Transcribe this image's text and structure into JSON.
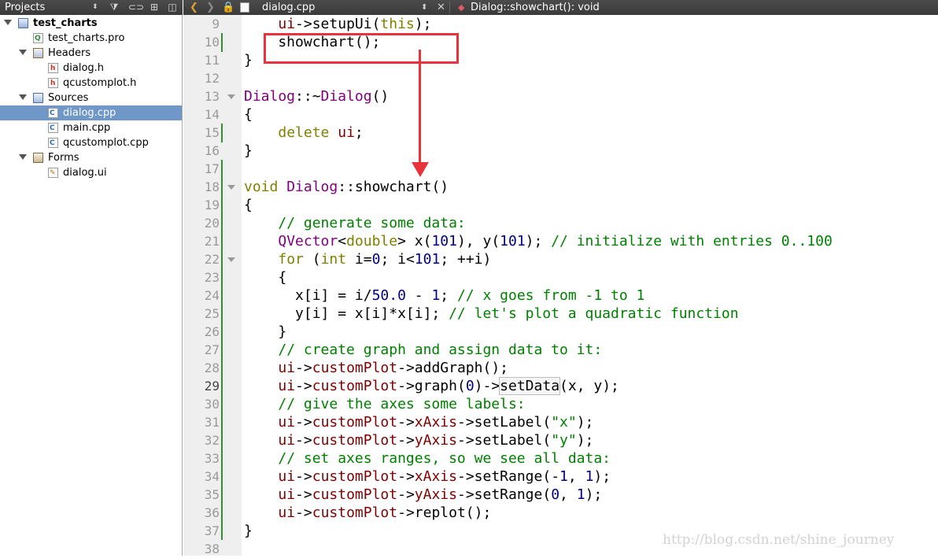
{
  "project_panel": {
    "title": "Projects",
    "tree": [
      {
        "label": "test_charts",
        "kind": "project",
        "level": 0,
        "expanded": true,
        "bold": true
      },
      {
        "label": "test_charts.pro",
        "kind": "file-pro",
        "level": 1
      },
      {
        "label": "Headers",
        "kind": "folder-h",
        "level": 1,
        "expanded": true
      },
      {
        "label": "dialog.h",
        "kind": "file-h",
        "level": 2
      },
      {
        "label": "qcustomplot.h",
        "kind": "file-h",
        "level": 2
      },
      {
        "label": "Sources",
        "kind": "folder-c",
        "level": 1,
        "expanded": true
      },
      {
        "label": "dialog.cpp",
        "kind": "file-c",
        "level": 2,
        "selected": true
      },
      {
        "label": "main.cpp",
        "kind": "file-c",
        "level": 2
      },
      {
        "label": "qcustomplot.cpp",
        "kind": "file-c",
        "level": 2
      },
      {
        "label": "Forms",
        "kind": "folder-f",
        "level": 1,
        "expanded": true
      },
      {
        "label": "dialog.ui",
        "kind": "file-ui",
        "level": 2
      }
    ]
  },
  "editor": {
    "file_name": "dialog.cpp",
    "symbol": "Dialog::showchart(): void",
    "current_line": 29,
    "lines": [
      {
        "no": 9,
        "text": "    ui->setupUi(this);"
      },
      {
        "no": 10,
        "text": "    showchart();"
      },
      {
        "no": 11,
        "text": "}"
      },
      {
        "no": 12,
        "text": ""
      },
      {
        "no": 13,
        "text": "Dialog::~Dialog()"
      },
      {
        "no": 14,
        "text": "{"
      },
      {
        "no": 15,
        "text": "    delete ui;"
      },
      {
        "no": 16,
        "text": "}"
      },
      {
        "no": 17,
        "text": ""
      },
      {
        "no": 18,
        "text": "void Dialog::showchart()"
      },
      {
        "no": 19,
        "text": "{"
      },
      {
        "no": 20,
        "text": "    // generate some data:"
      },
      {
        "no": 21,
        "text": "    QVector<double> x(101), y(101); // initialize with entries 0..100"
      },
      {
        "no": 22,
        "text": "    for (int i=0; i<101; ++i)"
      },
      {
        "no": 23,
        "text": "    {"
      },
      {
        "no": 24,
        "text": "      x[i] = i/50.0 - 1; // x goes from -1 to 1"
      },
      {
        "no": 25,
        "text": "      y[i] = x[i]*x[i]; // let's plot a quadratic function"
      },
      {
        "no": 26,
        "text": "    }"
      },
      {
        "no": 27,
        "text": "    // create graph and assign data to it:"
      },
      {
        "no": 28,
        "text": "    ui->customPlot->addGraph();"
      },
      {
        "no": 29,
        "text": "    ui->customPlot->graph(0)->setData(x, y);"
      },
      {
        "no": 30,
        "text": "    // give the axes some labels:"
      },
      {
        "no": 31,
        "text": "    ui->customPlot->xAxis->setLabel(\"x\");"
      },
      {
        "no": 32,
        "text": "    ui->customPlot->yAxis->setLabel(\"y\");"
      },
      {
        "no": 33,
        "text": "    // set axes ranges, so we see all data:"
      },
      {
        "no": 34,
        "text": "    ui->customPlot->xAxis->setRange(-1, 1);"
      },
      {
        "no": 35,
        "text": "    ui->customPlot->yAxis->setRange(0, 1);"
      },
      {
        "no": 36,
        "text": "    ui->customPlot->replot();"
      },
      {
        "no": 37,
        "text": "}"
      },
      {
        "no": 38,
        "text": ""
      }
    ]
  },
  "annotation": {
    "color": "#e8333c"
  },
  "watermark": "http://blog.csdn.net/shine_journey"
}
